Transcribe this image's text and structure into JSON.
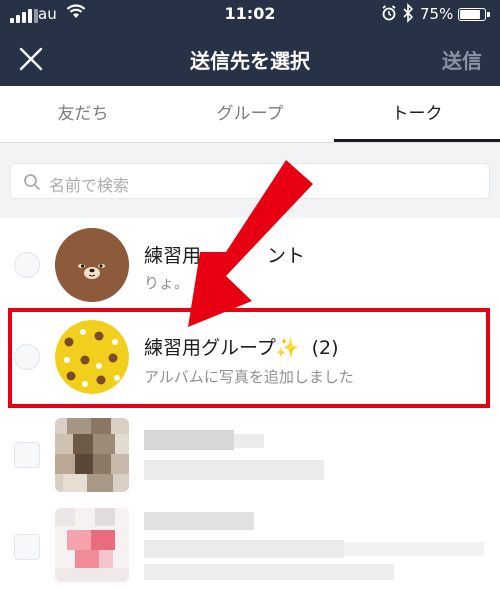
{
  "status_bar": {
    "carrier": "au",
    "time": "11:02",
    "battery_percent": "75%",
    "battery_level": 0.75,
    "icons": [
      "signal-icon",
      "wifi-icon",
      "alarm-icon",
      "bluetooth-icon",
      "battery-icon"
    ]
  },
  "nav": {
    "title": "送信先を選択",
    "send_label": "送信",
    "close_icon": "close-icon"
  },
  "tabs": [
    {
      "label": "友だち",
      "active": false
    },
    {
      "label": "グループ",
      "active": false
    },
    {
      "label": "トーク",
      "active": true
    }
  ],
  "search": {
    "placeholder": "名前で検索",
    "icon": "search-icon"
  },
  "list": [
    {
      "name": "練習用アカウント",
      "name_visible": "練習用",
      "name_tail": "ント",
      "subtitle": "りょ。",
      "avatar": "bear-face-avatar"
    },
    {
      "name": "練習用グループ✨",
      "count": "(2)",
      "subtitle": "アルバムに写真を追加しました",
      "avatar": "yellow-pattern-avatar"
    },
    {
      "name": "",
      "subtitle": "",
      "avatar": "pixelated-avatar"
    },
    {
      "name": "",
      "subtitle": "",
      "avatar": "pixelated-avatar"
    }
  ],
  "colors": {
    "header_bg": "#273246",
    "highlight": "#e60012",
    "arrow": "#e60012",
    "tab_active": "#1b1c1f",
    "search_bg": "#f2f3f5"
  }
}
